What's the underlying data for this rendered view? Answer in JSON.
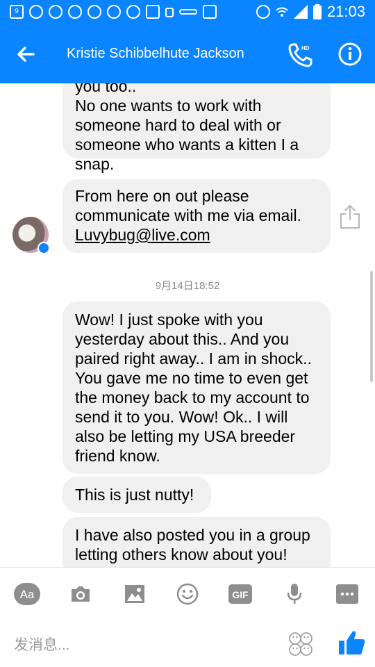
{
  "status_bar": {
    "time": "21:03",
    "icons": [
      "notification-icon",
      "weibo-icon",
      "qq-icon",
      "search-icon",
      "weibo-icon",
      "weibo-icon",
      "weibo-icon",
      "image-icon",
      "battery-saver-icon",
      "key-icon",
      "pocket-icon",
      "alarm-icon",
      "wifi-icon",
      "signal-icon",
      "battery-icon"
    ]
  },
  "header": {
    "title": "Kristie Schibbelhute Jackson",
    "call_badge": "HD"
  },
  "messages": [
    {
      "lines": "you too..\nNo one wants to work with someone hard to deal with or someone who wants a kitten I a snap."
    },
    {
      "text_before": "From here on out please communicate with me via email. ",
      "email": "Luvybug@live.com"
    },
    {
      "lines": "Wow! I just spoke with you yesterday about this.. And you paired right away.. I am in shock.. You gave me no time to even get the money back to my account to send it to you. Wow! Ok.. I will also be letting my USA breeder friend know."
    },
    {
      "lines": "This is just nutty!"
    },
    {
      "lines": "I have also posted you in a group letting others know about you!"
    }
  ],
  "timestamp": "9月14日18:52",
  "toolbar": {
    "aa_label": "Aa",
    "gif_label": "GIF"
  },
  "composer": {
    "placeholder": "发消息..."
  },
  "colors": {
    "brand": "#0a84ff",
    "bubble": "#f0f0f0",
    "icon_gray": "#8e8e8e"
  }
}
